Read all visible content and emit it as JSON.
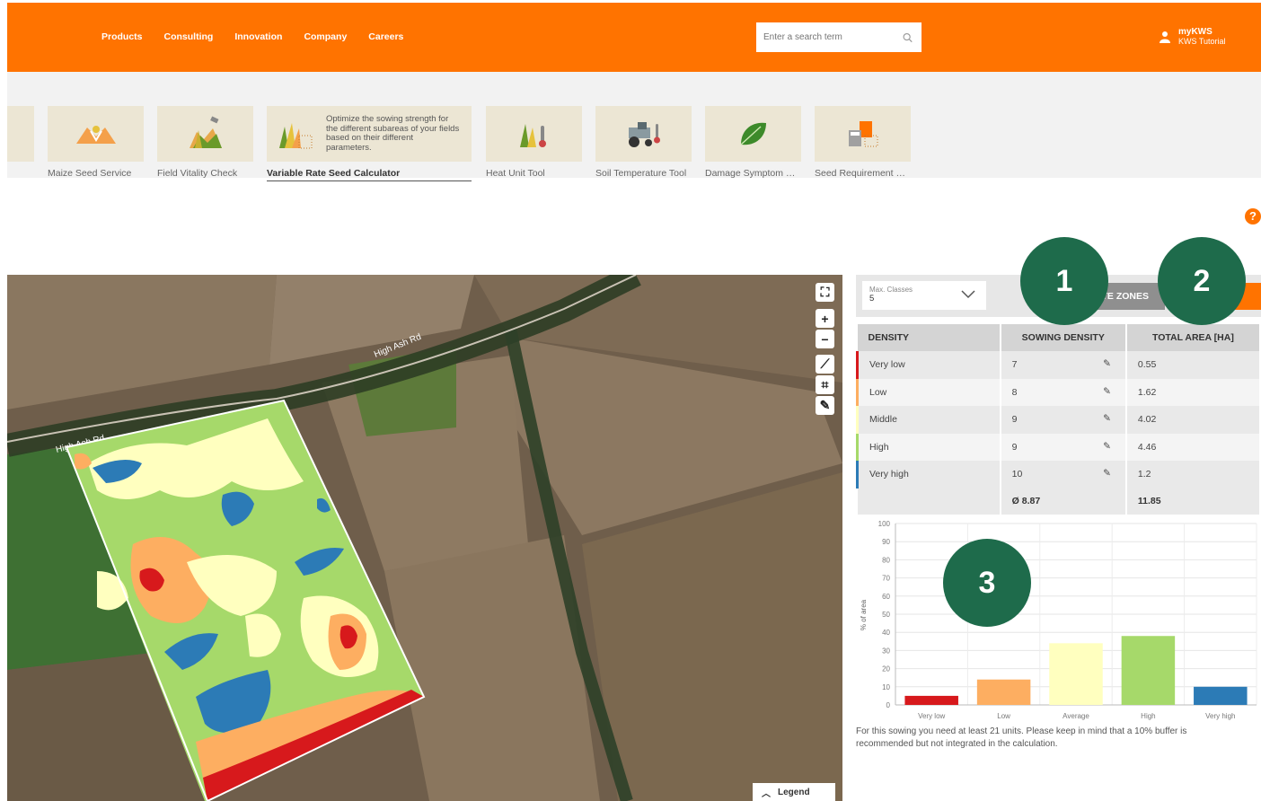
{
  "header": {
    "nav": [
      "Products",
      "Consulting",
      "Innovation",
      "Company",
      "Careers"
    ],
    "search_placeholder": "Enter a search term",
    "user_name": "myKWS",
    "user_sub": "KWS Tutorial"
  },
  "tools": [
    {
      "label": "Maize Seed Service",
      "icon": "hands-seed-icon"
    },
    {
      "label": "Field Vitality Check",
      "icon": "satellite-field-icon"
    },
    {
      "label": "Variable Rate Seed Calculator",
      "icon": "seed-calculator-icon",
      "description": "Optimize the sowing strength for the different subareas of your fields based on their different parameters."
    },
    {
      "label": "Heat Unit Tool",
      "icon": "thermometer-plant-icon"
    },
    {
      "label": "Soil Temperature Tool",
      "icon": "tractor-thermometer-icon"
    },
    {
      "label": "Damage Symptom …",
      "icon": "leaf-icon"
    },
    {
      "label": "Seed Requirement …",
      "icon": "seed-bag-calculator-icon"
    }
  ],
  "map": {
    "road_labels": [
      "High Ash Rd",
      "High Ash Rd"
    ],
    "legend_label": "Legend"
  },
  "panel": {
    "max_classes_label": "Max. Classes",
    "max_classes_value": "5",
    "zones_button": "TE ZONES",
    "columns": [
      "DENSITY",
      "SOWING DENSITY",
      "TOTAL AREA [HA]"
    ],
    "rows": [
      {
        "density": "Very low",
        "sowing": "7",
        "area": "0.55",
        "color": "#d7191c"
      },
      {
        "density": "Low",
        "sowing": "8",
        "area": "1.62",
        "color": "#fdae61"
      },
      {
        "density": "Middle",
        "sowing": "9",
        "area": "4.02",
        "color": "#ffffbf"
      },
      {
        "density": "High",
        "sowing": "9",
        "area": "4.46",
        "color": "#a6d96a"
      },
      {
        "density": "Very high",
        "sowing": "10",
        "area": "1.2",
        "color": "#2c7bb6"
      }
    ],
    "avg_sowing": "Ø 8.87",
    "total_area": "11.85"
  },
  "chart_data": {
    "type": "bar",
    "categories": [
      "Very low",
      "Low",
      "Average",
      "High",
      "Very high"
    ],
    "values": [
      5,
      14,
      34,
      38,
      10
    ],
    "colors": [
      "#d7191c",
      "#fdae61",
      "#ffffbf",
      "#a6d96a",
      "#2c7bb6"
    ],
    "ylabel": "% of area",
    "ylim": [
      0,
      100
    ],
    "yticks": [
      0,
      10,
      20,
      30,
      40,
      50,
      60,
      70,
      80,
      90,
      100
    ],
    "grid": true
  },
  "note": "For this sowing you need at least 21 units. Please keep in mind that a 10% buffer is recommended but not integrated in the calculation.",
  "callouts": [
    "1",
    "2",
    "3"
  ]
}
